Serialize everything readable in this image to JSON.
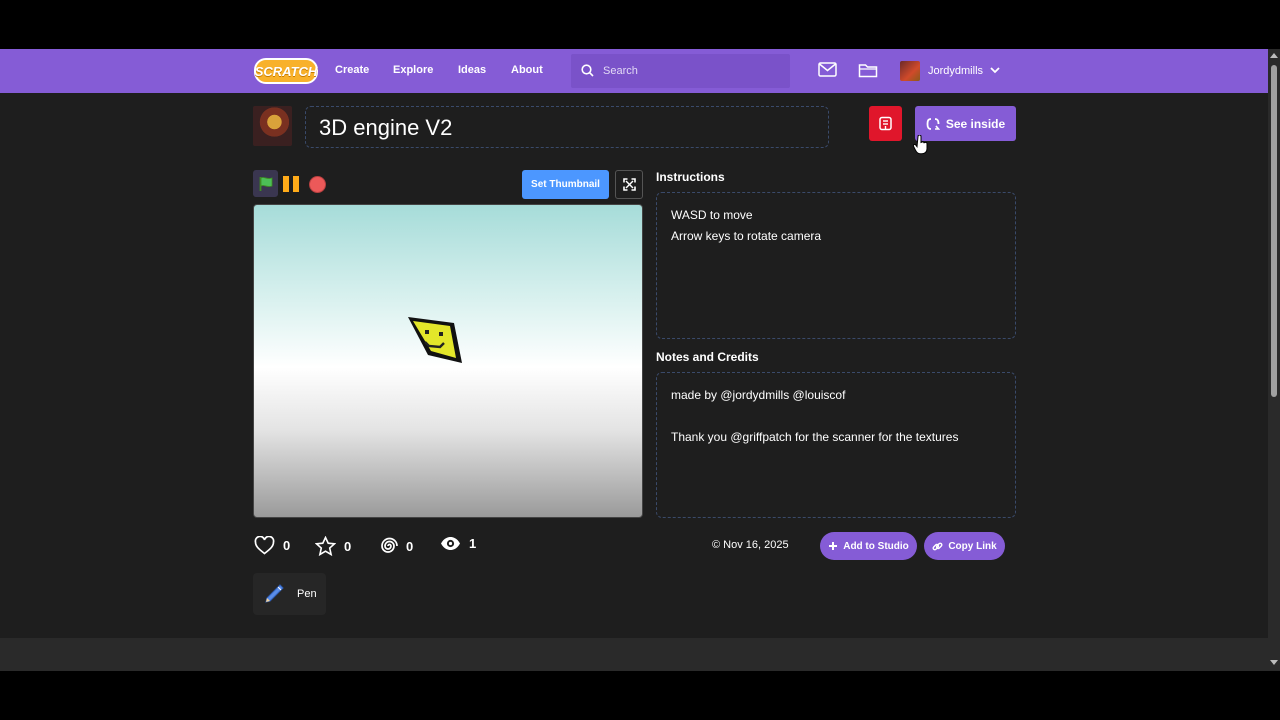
{
  "nav": {
    "logo_text": "SCRATCH",
    "links": [
      "Create",
      "Explore",
      "Ideas",
      "About"
    ],
    "search_placeholder": "Search",
    "username": "Jordydmills",
    "accent_color": "#855cd6"
  },
  "project": {
    "title": "3D engine V2",
    "see_inside_label": "See inside",
    "set_thumbnail_label": "Set Thumbnail"
  },
  "instructions": {
    "heading": "Instructions",
    "lines": [
      "WASD to move",
      "Arrow keys to rotate camera"
    ]
  },
  "notes": {
    "heading": "Notes and Credits",
    "lines": [
      "made by @jordydmills @louiscof",
      "Thank you @griffpatch for the scanner for the textures"
    ]
  },
  "stats": {
    "loves": "0",
    "favorites": "0",
    "remixes": "0",
    "views": "1"
  },
  "meta": {
    "date": "Nov 16, 2025",
    "add_to_studio_label": "Add to Studio",
    "copy_link_label": "Copy Link"
  },
  "extensions": [
    {
      "label": "Pen",
      "icon": "pen-icon"
    }
  ]
}
